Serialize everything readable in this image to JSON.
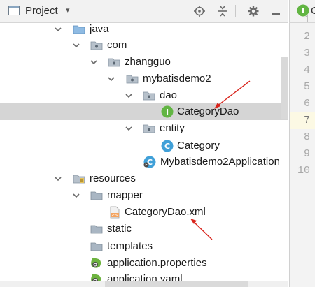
{
  "toolbar": {
    "project_label": "Project",
    "caret": "▾"
  },
  "tree": [
    {
      "name": "java",
      "icon": "folder-blue-icon",
      "expanded": true
    },
    {
      "name": "com",
      "icon": "package-icon",
      "expanded": true
    },
    {
      "name": "zhangguo",
      "icon": "package-icon",
      "expanded": true
    },
    {
      "name": "mybatisdemo2",
      "icon": "package-icon",
      "expanded": true
    },
    {
      "name": "dao",
      "icon": "package-icon",
      "expanded": true
    },
    {
      "name": "CategoryDao",
      "icon": "interface-icon",
      "icon_letter": "I",
      "selected": true
    },
    {
      "name": "entity",
      "icon": "package-icon",
      "expanded": true
    },
    {
      "name": "Category",
      "icon": "class-icon",
      "icon_letter": "C"
    },
    {
      "name": "Mybatisdemo2Application",
      "icon": "spring-boot-app-icon"
    },
    {
      "name": "resources",
      "icon": "resources-folder-icon",
      "expanded": true
    },
    {
      "name": "mapper",
      "icon": "folder-gray-icon",
      "expanded": true
    },
    {
      "name": "CategoryDao.xml",
      "icon": "xml-file-icon"
    },
    {
      "name": "static",
      "icon": "folder-gray-icon"
    },
    {
      "name": "templates",
      "icon": "folder-gray-icon"
    },
    {
      "name": "application.properties",
      "icon": "spring-config-icon"
    },
    {
      "name": "application.yaml",
      "icon": "spring-config-icon"
    }
  ],
  "editor": {
    "tab_label": "C",
    "tab_icon_letter": "I",
    "line_numbers": [
      "1",
      "2",
      "3",
      "4",
      "5",
      "6",
      "7",
      "8",
      "9",
      "10"
    ],
    "current_line": "7"
  },
  "colors": {
    "selection": "#d5d5d5",
    "interface_icon": "#62b543",
    "class_icon": "#40a0d8",
    "annotation_arrow": "#d9241c",
    "folder_blue": "#8fbbe3",
    "folder_gray": "#a9b6c3"
  }
}
